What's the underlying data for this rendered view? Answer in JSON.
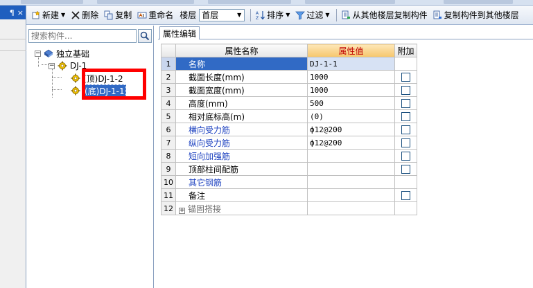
{
  "toolbar": {
    "new_label": "新建",
    "delete_label": "删除",
    "copy_label": "复制",
    "rename_label": "重命名",
    "floor_label": "楼层",
    "floor_value": "首层",
    "sort_label": "排序",
    "filter_label": "过滤",
    "copy_from_floor_label": "从其他楼层复制构件",
    "copy_to_floor_label": "复制构件到其他楼层"
  },
  "dock": {
    "pin_glyph": "¶",
    "close_glyph": "×"
  },
  "search": {
    "placeholder": "搜索构件..."
  },
  "tree": {
    "root_label": "独立基础",
    "group_label": "DJ-1",
    "child_top_label": "(顶)DJ-1-2",
    "child_bottom_label": "(底)DJ-1-1"
  },
  "tab": {
    "label": "属性编辑"
  },
  "grid": {
    "headers": {
      "name": "属性名称",
      "value": "属性值",
      "attach": "附加"
    },
    "rows": [
      {
        "num": "1",
        "name": "名称",
        "value": "DJ-1-1",
        "checkbox": false
      },
      {
        "num": "2",
        "name": "截面长度(mm)",
        "value": "1000",
        "checkbox": true
      },
      {
        "num": "3",
        "name": "截面宽度(mm)",
        "value": "1000",
        "checkbox": true
      },
      {
        "num": "4",
        "name": "高度(mm)",
        "value": "500",
        "checkbox": true
      },
      {
        "num": "5",
        "name": "相对底标高(m)",
        "value": "(0)",
        "checkbox": true
      },
      {
        "num": "6",
        "name": "横向受力筋",
        "value": "ф12@200",
        "checkbox": true
      },
      {
        "num": "7",
        "name": "纵向受力筋",
        "value": "ф12@200",
        "checkbox": true
      },
      {
        "num": "8",
        "name": "短向加强筋",
        "value": "",
        "checkbox": true
      },
      {
        "num": "9",
        "name": "顶部柱间配筋",
        "value": "",
        "checkbox": true
      },
      {
        "num": "10",
        "name": "其它钢筋",
        "value": "",
        "checkbox": false
      },
      {
        "num": "11",
        "name": "备注",
        "value": "",
        "checkbox": true
      },
      {
        "num": "12",
        "name": "锚固搭接",
        "value": "",
        "checkbox": false
      }
    ]
  },
  "colors": {
    "selection": "#316ac5",
    "highlight_box": "#ff0000",
    "value_header_text": "#c00000",
    "rebar_name_text": "#1a3fbf"
  }
}
